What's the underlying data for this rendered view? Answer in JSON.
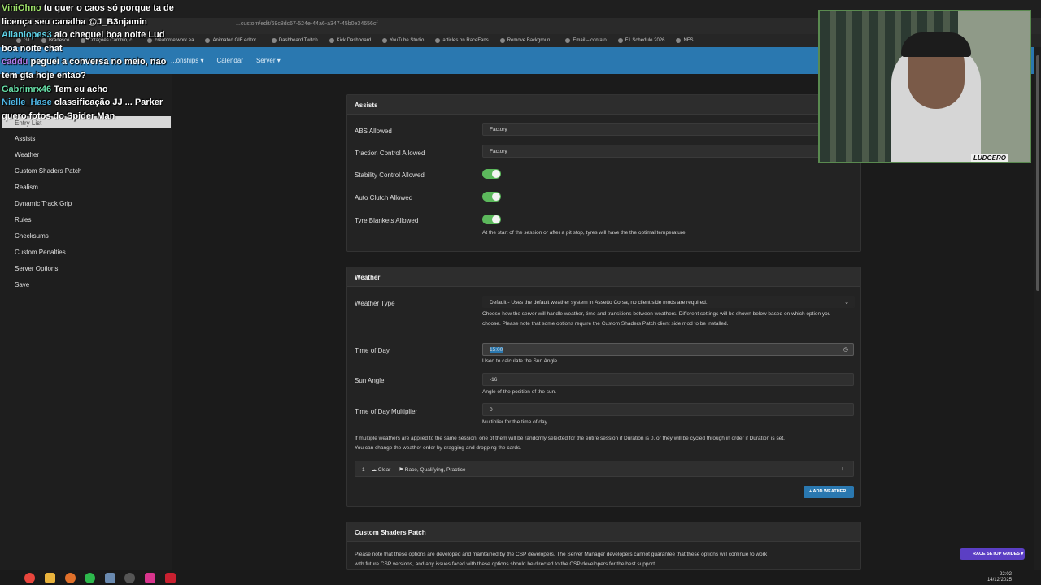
{
  "browser": {
    "url": "...custom/edit/69c8dc67-524e-44a6-a347-45b0e34656cf",
    "bookmarks": [
      "G1",
      "Bradesco",
      "Cotações Câmbio, c...",
      "creatornetwork.ea",
      "Animated GIF editor...",
      "Dashboard Twitch",
      "Kick Dashboard",
      "YouTube Studio",
      "articles on RaceFans",
      "Remove Backgroun...",
      "Email – contato",
      "F1 Schedule 2026",
      "NFS"
    ]
  },
  "navbar": {
    "items": [
      "...onships ▾",
      "Calendar",
      "Server ▾"
    ]
  },
  "sidebar": {
    "items": [
      "Entry List",
      "Assists",
      "Weather",
      "Custom Shaders Patch",
      "Realism",
      "Dynamic Track Grip",
      "Rules",
      "Checksums",
      "Custom Penalties",
      "Server Options",
      "Save"
    ]
  },
  "assists": {
    "title": "Assists",
    "abs_label": "ABS Allowed",
    "abs_value": "Factory",
    "tc_label": "Traction Control Allowed",
    "tc_value": "Factory",
    "stability_label": "Stability Control Allowed",
    "autoclutch_label": "Auto Clutch Allowed",
    "tyre_label": "Tyre Blankets Allowed",
    "tyre_help": "At the start of the session or after a pit stop, tyres will have the the optimal temperature."
  },
  "weather": {
    "title": "Weather",
    "type_label": "Weather Type",
    "type_value": "Default - Uses the default weather system in Assetto Corsa, no client side mods are required.",
    "type_help1": "Choose how the server will handle weather, time and transitions between weathers. Different settings will be shown below based on which option you",
    "type_help2": "choose. Please note that some options require the Custom Shaders Patch client side mod to be installed.",
    "tod_label": "Time of Day",
    "tod_value": "15:00",
    "tod_help": "Used to calculate the Sun Angle.",
    "sun_label": "Sun Angle",
    "sun_value": "-16",
    "sun_help": "Angle of the position of the sun.",
    "mult_label": "Time of Day Multiplier",
    "mult_value": "0",
    "mult_help": "Multiplier for the time of day.",
    "info1": "If multiple weathers are applied to the same session, one of them will be randomly selected for the entire session if Duration is 0, or they will be cycled through in order if Duration is set.",
    "info2": "You can change the weather order by dragging and dropping the cards.",
    "row_index": "1",
    "row_weather": "Clear",
    "row_sessions": "Race, Qualifying, Practice",
    "add_button": "ADD WEATHER"
  },
  "csp": {
    "title": "Custom Shaders Patch",
    "help1": "Please note that these options are developed and maintained by the CSP developers. The Server Manager developers cannot guarantee that these options will continue to work",
    "help2": "with future CSP versions, and any issues faced with these options should be directed to the CSP developers for the best support."
  },
  "guides_button": "RACE SETUP GUIDES ▾",
  "chat": [
    {
      "user": "ViniOhno",
      "msg": "tu quer o caos só porque ta de licença seu canalha @J_B3njamin"
    },
    {
      "user": "Allanlopes3",
      "msg": "alo cheguei boa noite Lud boa noite chat"
    },
    {
      "user": "caddu",
      "msg": "peguei a conversa no meio, nao tem gta hoje entao?"
    },
    {
      "user": "Gabrimrx46",
      "msg": "Tem eu acho"
    },
    {
      "user": "Nielle_Hase",
      "msg": "classificação JJ ... Parker quero fotos do Spider Man"
    }
  ],
  "webcam": {
    "logo": "LUDGERO"
  },
  "clock": {
    "time": "22:02",
    "date": "14/12/2025"
  },
  "colors": {
    "navbar": "#2a78b0",
    "toggle_on": "#5cb85c",
    "button": "#2a78b0",
    "guides": "#5b3fc4"
  }
}
